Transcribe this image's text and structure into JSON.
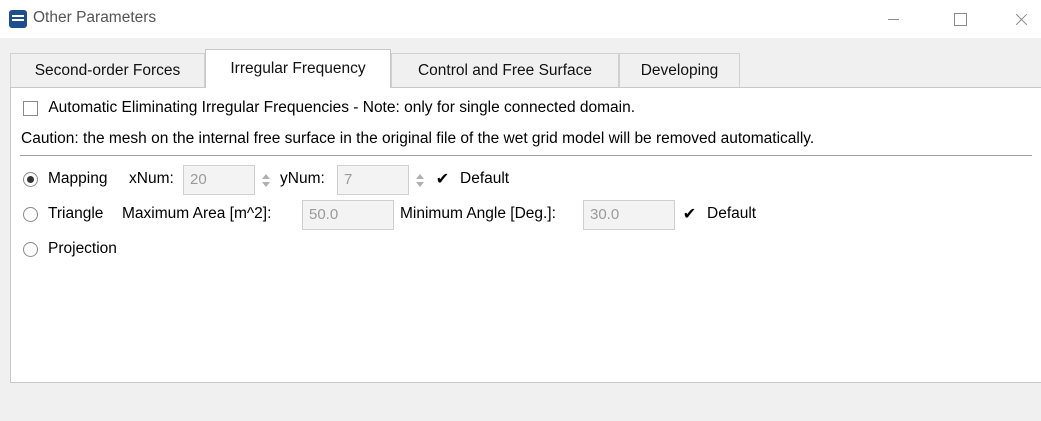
{
  "window": {
    "title": "Other Parameters",
    "icon": "app-logo-icon",
    "controls": {
      "minimize": "minimize-icon",
      "maximize": "maximize-icon",
      "close": "close-icon"
    }
  },
  "tabs": [
    {
      "label": "Second-order Forces",
      "active": false
    },
    {
      "label": "Irregular Frequency",
      "active": true
    },
    {
      "label": "Control and Free Surface",
      "active": false
    },
    {
      "label": "Developing",
      "active": false
    }
  ],
  "panel": {
    "auto_eliminate": {
      "label": "Automatic Eliminating Irregular Frequencies - Note: only for single connected domain.",
      "checked": false
    },
    "caution": "Caution: the mesh on the internal free surface in the original file of the wet grid model will be removed automatically.",
    "methods": {
      "mapping": {
        "label": "Mapping",
        "selected": true,
        "xnum_label": "xNum:",
        "xnum_value": "20",
        "ynum_label": "yNum:",
        "ynum_value": "7",
        "default_label": "Default",
        "default_checked": true
      },
      "triangle": {
        "label": "Triangle",
        "selected": false,
        "max_area_label": "Maximum Area [m^2]:",
        "max_area_value": "50.0",
        "min_angle_label": "Minimum Angle [Deg.]:",
        "min_angle_value": "30.0",
        "default_label": "Default",
        "default_checked": true
      },
      "projection": {
        "label": "Projection",
        "selected": false
      }
    }
  },
  "checkmark_glyph": "✔"
}
